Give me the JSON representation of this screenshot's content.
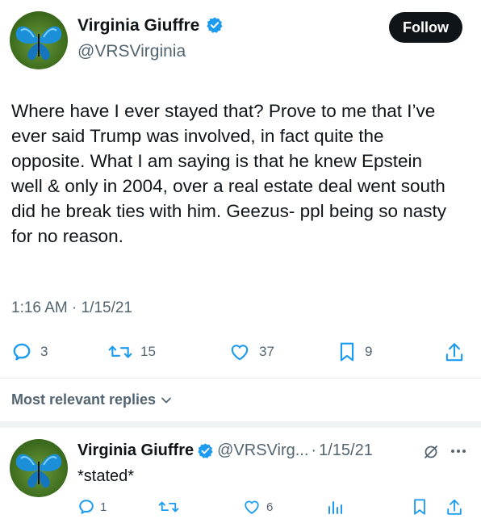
{
  "tweet": {
    "author_name": "Virginia Giuffre",
    "author_handle": "@VRSVirginia",
    "follow_label": "Follow",
    "text": "Where have I ever stayed that? Prove to me that I’ve ever said Trump was involved, in fact quite the opposite. What I am saying is that he knew Epstein well & only in 2004, over a real estate deal went south did he break ties with him. Geezus- ppl being so nasty for no reason.",
    "time": "1:16 AM",
    "date": "1/15/21",
    "time_sep": "·",
    "stats": {
      "replies": "3",
      "retweets": "15",
      "likes": "37",
      "bookmarks": "9"
    }
  },
  "replies_sort_label": "Most relevant replies",
  "reply": {
    "author_name": "Virginia Giuffre",
    "author_handle": "@VRSVirg...",
    "sep": "·",
    "date": "1/15/21",
    "text": "*stated*",
    "stats": {
      "replies": "1",
      "likes": "6"
    }
  },
  "colors": {
    "verified": "#1d9bf0",
    "text": "#0f1419",
    "secondary": "#536471"
  }
}
